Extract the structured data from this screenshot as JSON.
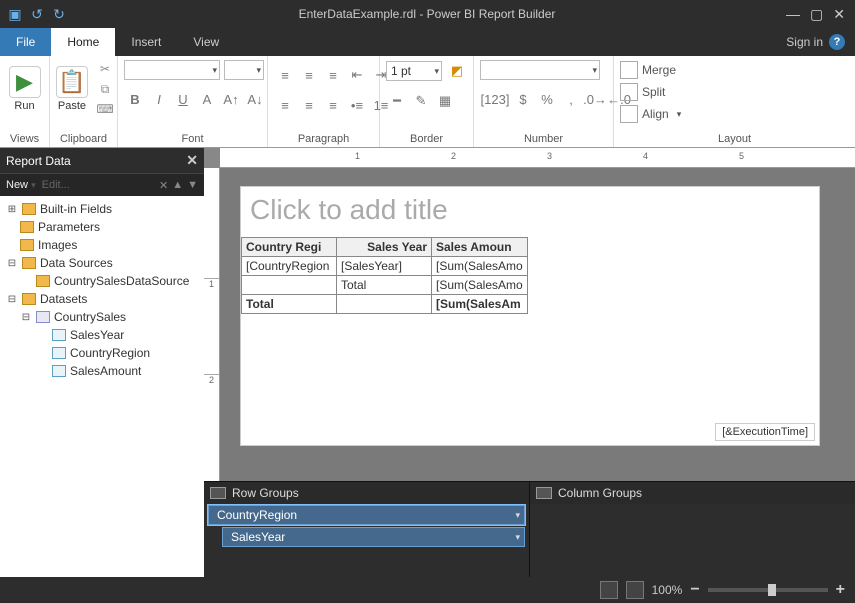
{
  "title": "EnterDataExample.rdl - Power BI Report Builder",
  "tabs": {
    "file": "File",
    "home": "Home",
    "insert": "Insert",
    "view": "View"
  },
  "signin": "Sign in",
  "ribbon": {
    "views": {
      "run": "Run",
      "label": "Views"
    },
    "clipboard": {
      "paste": "Paste",
      "label": "Clipboard"
    },
    "font": {
      "label": "Font"
    },
    "paragraph": {
      "label": "Paragraph"
    },
    "border": {
      "pt": "1 pt",
      "label": "Border"
    },
    "number": {
      "label": "Number"
    },
    "layout": {
      "merge": "Merge",
      "split": "Split",
      "align": "Align",
      "label": "Layout"
    }
  },
  "reportData": {
    "header": "Report Data",
    "new": "New",
    "edit": "Edit...",
    "nodes": {
      "builtIn": "Built-in Fields",
      "parameters": "Parameters",
      "images": "Images",
      "dataSources": "Data Sources",
      "dataSource1": "CountrySalesDataSource",
      "datasets": "Datasets",
      "dataset1": "CountrySales",
      "field1": "SalesYear",
      "field2": "CountryRegion",
      "field3": "SalesAmount"
    }
  },
  "ruler": {
    "one": "1",
    "two": "2",
    "three": "3",
    "four": "4",
    "five": "5"
  },
  "design": {
    "titlePlaceholder": "Click to add title",
    "headers": {
      "a": "Country Regi",
      "b": "Sales Year",
      "c": "Sales Amoun"
    },
    "row1": {
      "a": "[CountryRegion",
      "b": "[SalesYear]",
      "c": "[Sum(SalesAmo"
    },
    "row2": {
      "a": "",
      "b": "Total",
      "c": "[Sum(SalesAmo"
    },
    "row3": {
      "a": "Total",
      "b": "",
      "c": "[Sum(SalesAm"
    },
    "execTime": "[&ExecutionTime]"
  },
  "groups": {
    "rowLabel": "Row Groups",
    "colLabel": "Column Groups",
    "rowItems": {
      "a": "CountryRegion",
      "b": "SalesYear"
    }
  },
  "status": {
    "zoom": "100%"
  }
}
